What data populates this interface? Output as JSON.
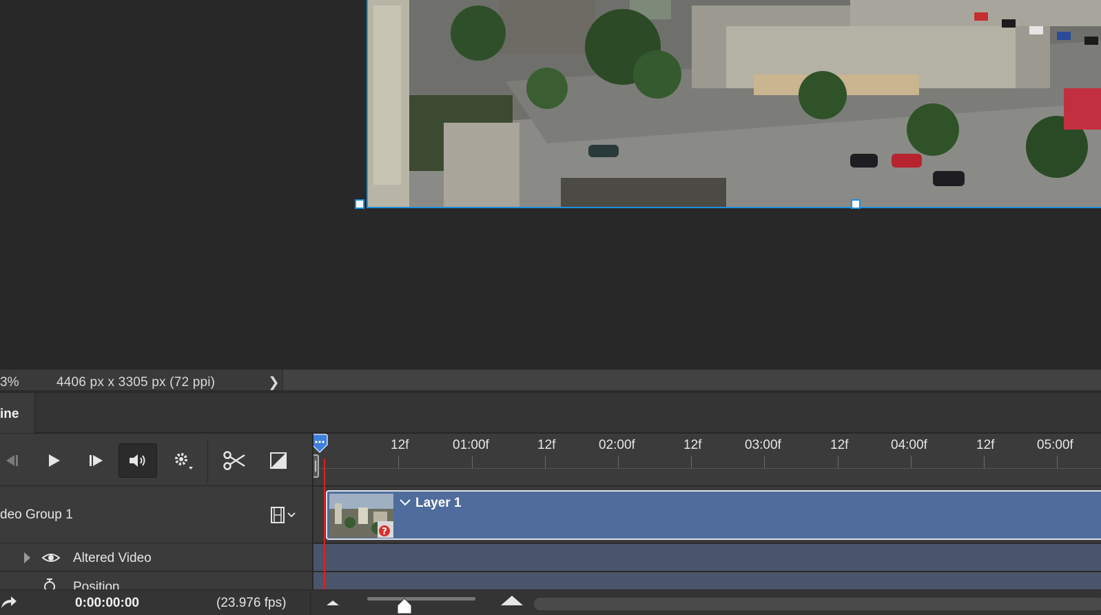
{
  "status_bar": {
    "zoom": "3%",
    "doc_info": "4406 px x 3305 px (72 ppi)",
    "arrow": "❯"
  },
  "panel": {
    "tab_label": "ine"
  },
  "controls": {
    "prev_frame_icon": "prev-frame-icon",
    "play_icon": "play-icon",
    "next_frame_icon": "next-frame-icon",
    "audio_icon": "speaker-icon",
    "settings_icon": "gear-icon",
    "split_icon": "scissors-icon",
    "transition_icon": "transition-icon"
  },
  "ruler": {
    "labels": [
      "12f",
      "01:00f",
      "12f",
      "02:00f",
      "12f",
      "03:00f",
      "12f",
      "04:00f",
      "12f",
      "05:00f"
    ]
  },
  "tracks": {
    "group_name": "deo Group 1",
    "clip_name": "Layer 1",
    "altered_video": "Altered Video",
    "position": "Position"
  },
  "bottom": {
    "time_code": "0:00:00:00",
    "fps": "(23.976 fps)"
  },
  "colors": {
    "accent": "#1b8fe0",
    "clip": "#4f6c9c",
    "playhead": "#e02020",
    "track_bg": "#4a546a"
  }
}
